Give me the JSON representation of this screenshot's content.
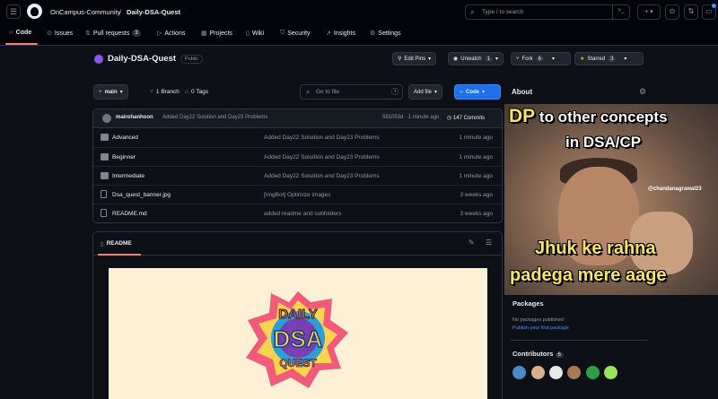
{
  "header": {
    "org": "OnCampus-Community",
    "separator": "/",
    "repo": "Daily-DSA-Quest",
    "search_placeholder": "Type / to search",
    "search_key": ">_",
    "plus_label": "+ ▾"
  },
  "tabs": [
    {
      "label": "Code"
    },
    {
      "label": "Issues"
    },
    {
      "label": "Pull requests",
      "count": "3"
    },
    {
      "label": "Actions"
    },
    {
      "label": "Projects"
    },
    {
      "label": "Wiki"
    },
    {
      "label": "Security"
    },
    {
      "label": "Insights"
    },
    {
      "label": "Settings"
    }
  ],
  "repo": {
    "name": "Daily-DSA-Quest",
    "visibility": "Public",
    "edit_pins": "Edit Pins",
    "unwatch": "Unwatch",
    "unwatch_count": "1",
    "fork": "Fork",
    "fork_count": "6",
    "starred": "Starred",
    "star_count": "3"
  },
  "branchbar": {
    "branch": "main",
    "branches": "1 Branch",
    "tags": "0 Tags",
    "goto_placeholder": "Go to file",
    "goto_key": "t",
    "add_file": "Add file",
    "code": "Code"
  },
  "commit": {
    "author": "mairohanhoon",
    "message": "Added Day22 Solution and Day23 Problems",
    "hash_time": "591053d · 1 minute ago",
    "count": "147 Commits"
  },
  "files": [
    {
      "name": "Advanced",
      "type": "folder",
      "message": "Added Day22 Soluition and Day23 Problems",
      "time": "1 minute ago"
    },
    {
      "name": "Beginner",
      "type": "folder",
      "message": "Added Day22 Soluition and Day23 Problems",
      "time": "1 minute ago"
    },
    {
      "name": "Intermediate",
      "type": "folder",
      "message": "Added Day22 Soluition and Day23 Problems",
      "time": "1 minute ago"
    },
    {
      "name": "Dsa_quest_banner.jpg",
      "type": "file",
      "message": "[ImgBot] Optimize images",
      "time": "3 weeks ago"
    },
    {
      "name": "README.md",
      "type": "file",
      "message": "added readme and subfolders",
      "time": "3 weeks ago"
    }
  ],
  "readme": {
    "tab": "README",
    "logo_line1": "DAILY",
    "logo_line2": "DSA",
    "logo_line3": "QUEST"
  },
  "sidebar": {
    "about": "About",
    "meme_top_a": "DP",
    "meme_top_b": " to other concepts",
    "meme_top_c": "in DSA/CP",
    "meme_handle": "@chandanagrawal23",
    "meme_bottom_a": "Jhuk ke rahna",
    "meme_bottom_b": "padega mere aage",
    "packages": "Packages",
    "no_packages": "No packages published",
    "publish_link": "Publish your first package",
    "contributors": "Contributors",
    "contributors_count": "6"
  }
}
